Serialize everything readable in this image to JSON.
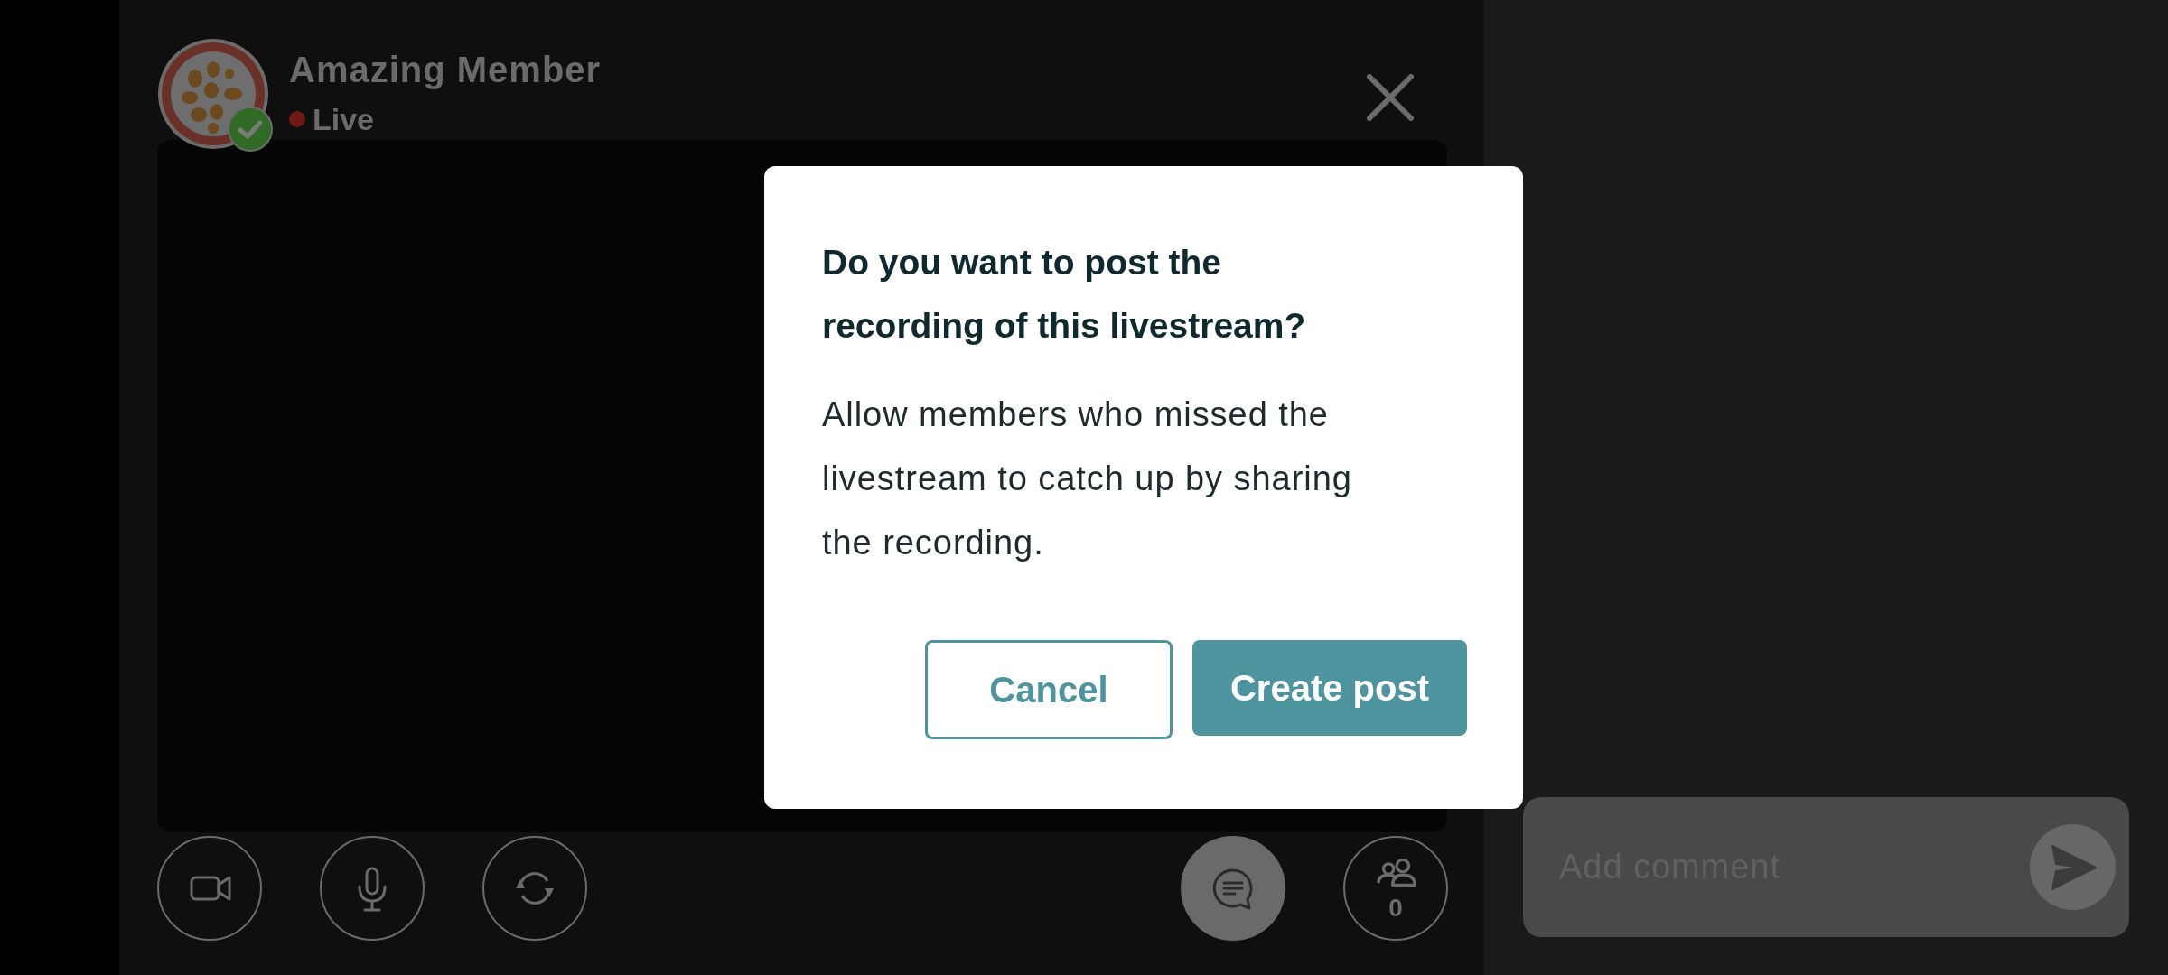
{
  "header": {
    "name": "Amazing Member",
    "status": "Live",
    "verified": true
  },
  "dialog": {
    "title": "Do you want to post the recording of this livestream?",
    "message": "Allow members who missed the livestream to catch up by sharing the recording.",
    "buttons": [
      {
        "label": "Cancel",
        "kind": "secondary"
      },
      {
        "label": "Create post",
        "kind": "primary"
      }
    ]
  },
  "controls": [
    {
      "kind": "camera",
      "selected": false
    },
    {
      "kind": "microphone",
      "selected": false
    },
    {
      "kind": "switch-camera",
      "selected": false
    },
    {
      "kind": "chat",
      "selected": true
    },
    {
      "kind": "viewers",
      "selected": false,
      "count": "0"
    }
  ],
  "comment": {
    "placeholder": "Add comment"
  }
}
